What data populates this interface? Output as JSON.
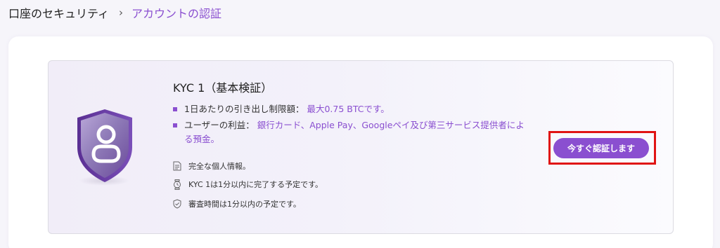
{
  "breadcrumb": {
    "root": "口座のセキュリティ",
    "separator": "›",
    "current": "アカウントの認証"
  },
  "kyc": {
    "title": "KYC 1（基本検証）",
    "bullets": [
      {
        "label": "1日あたりの引き出し制限額：",
        "value": "最大0.75 BTCです。"
      },
      {
        "label": "ユーザーの利益：",
        "value_line1": "銀行カード、Apple Pay、Googleペイ及び第三サービス提供者によ",
        "value_line2": "る預金。"
      }
    ],
    "requirements": [
      {
        "icon": "document-icon",
        "text": "完全な個人情報。"
      },
      {
        "icon": "stopwatch-icon",
        "text": "KYC 1は1分以内に完了する予定です。"
      },
      {
        "icon": "shield-check-icon",
        "text": "審査時間は1分以内の予定です。"
      }
    ],
    "cta_label": "今すぐ認証します"
  },
  "colors": {
    "accent": "#8a4fd0",
    "highlight_box": "#e01414"
  }
}
